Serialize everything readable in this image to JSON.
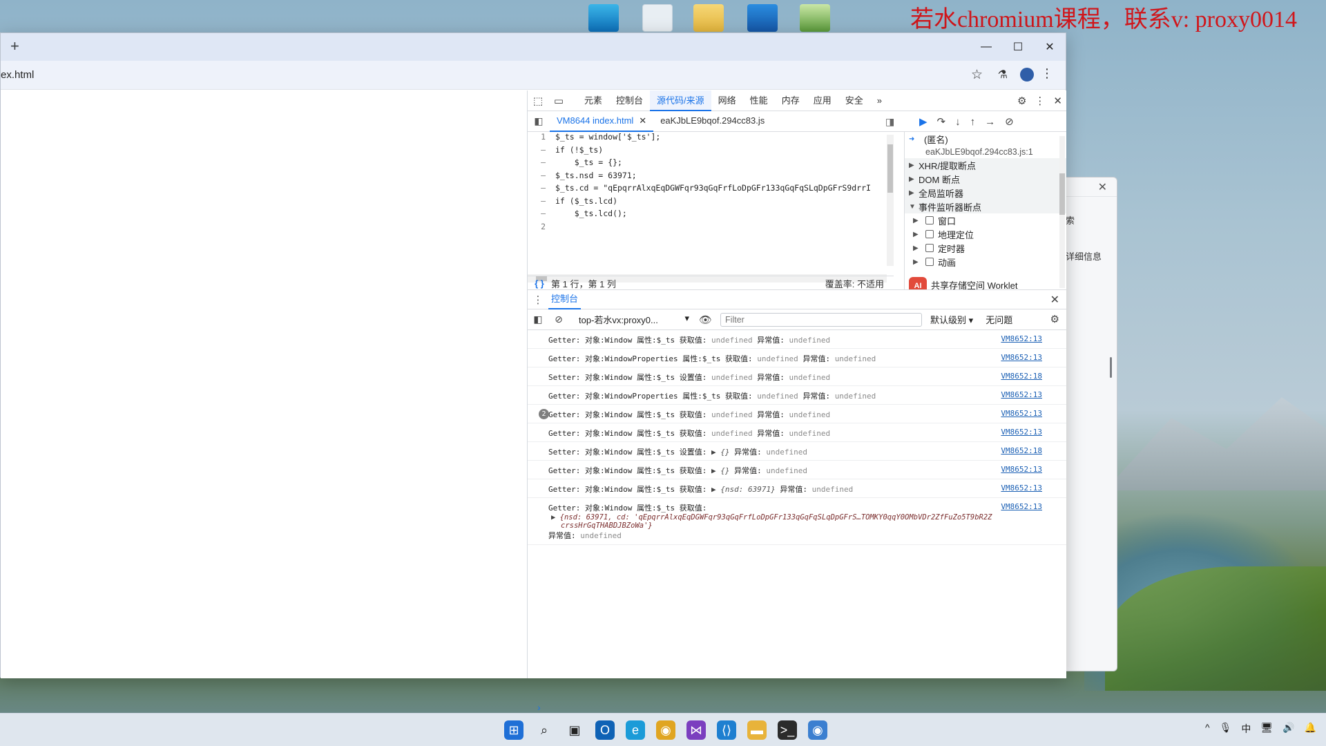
{
  "watermark": "若水chromium课程，联系v: proxy0014",
  "desktop_icons": [
    "monitor-icon",
    "recycle-bin-icon",
    "folder-icon",
    "media-icon",
    "notepad-icon"
  ],
  "back_window": {
    "text1": "索",
    "text2": "详细信息"
  },
  "browser": {
    "new_tab": "+",
    "window_controls": {
      "minimize": "—",
      "maximize": "☐",
      "close": "✕"
    },
    "url": "ex.html"
  },
  "devtools": {
    "tabs": [
      "元素",
      "控制台",
      "源代码/来源",
      "网络",
      "性能",
      "内存",
      "应用",
      "安全"
    ],
    "active_tab": "源代码/来源",
    "more": "»",
    "sources": {
      "file_tabs": [
        {
          "label": "VM8644 index.html",
          "active": true
        },
        {
          "label": "eaKJbLE9bqof.294cc83.js",
          "active": false
        }
      ],
      "code_lines": [
        {
          "ln": "1",
          "code": "$_ts = window['$_ts'];"
        },
        {
          "ln": "–",
          "code": "if (!$_ts)"
        },
        {
          "ln": "–",
          "code": "    $_ts = {};"
        },
        {
          "ln": "–",
          "code": "$_ts.nsd = 63971;"
        },
        {
          "ln": "–",
          "code": "$_ts.cd = \"qEpqrrAlxqEqDGWFqr93qGqFrfLoDpGFr133qGqFqSLqDpGFrS9drrI"
        },
        {
          "ln": "–",
          "code": "if ($_ts.lcd)"
        },
        {
          "ln": "–",
          "code": "    $_ts.lcd();"
        },
        {
          "ln": "2",
          "code": ""
        }
      ],
      "status_position": "第 1 行，第 1 列",
      "coverage": "覆盖率: 不适用"
    },
    "debugger": {
      "anon_label": "(匿名)",
      "anon_file": "eaKJbLE9bqof.294cc83.js:1",
      "sections": [
        {
          "label": "XHR/提取断点",
          "expanded": false
        },
        {
          "label": "DOM 断点",
          "expanded": false
        },
        {
          "label": "全局监听器",
          "expanded": false
        },
        {
          "label": "事件监听器断点",
          "expanded": true
        }
      ],
      "event_items": [
        "窗口",
        "地理定位",
        "定时器",
        "动画"
      ],
      "ai_label": "AI",
      "shared_storage": "共享存储空间 Worklet"
    },
    "console": {
      "drawer_tab": "控制台",
      "context": "top-若水vx:proxy0...",
      "filter_placeholder": "Filter",
      "level": "默认级别 ▾",
      "issues": "无问题",
      "logs": [
        {
          "kind": "Getter:",
          "obj": "Window",
          "action": "获取值:",
          "value": "undefined",
          "exc": "undefined",
          "src": "VM8652:13"
        },
        {
          "kind": "Getter:",
          "obj": "WindowProperties",
          "action": "获取值:",
          "value": "undefined",
          "exc": "undefined",
          "src": "VM8652:13"
        },
        {
          "kind": "Setter:",
          "obj": "Window",
          "action": "设置值:",
          "value": "undefined",
          "exc": "undefined",
          "src": "VM8652:18"
        },
        {
          "kind": "Getter:",
          "obj": "WindowProperties",
          "action": "获取值:",
          "value": "undefined",
          "exc": "undefined",
          "src": "VM8652:13"
        },
        {
          "kind": "Getter:",
          "obj": "Window",
          "action": "获取值:",
          "value": "undefined",
          "exc": "undefined",
          "src": "VM8652:13",
          "count": "2"
        },
        {
          "kind": "Getter:",
          "obj": "Window",
          "action": "获取值:",
          "value": "undefined",
          "exc": "undefined",
          "src": "VM8652:13"
        },
        {
          "kind": "Setter:",
          "obj": "Window",
          "action": "设置值:",
          "value": "{}",
          "exc": "undefined",
          "src": "VM8652:18",
          "expandable": true
        },
        {
          "kind": "Getter:",
          "obj": "Window",
          "action": "获取值:",
          "value": "{}",
          "exc": "undefined",
          "src": "VM8652:13",
          "expandable": true
        },
        {
          "kind": "Getter:",
          "obj": "Window",
          "action": "获取值:",
          "value": "{nsd: 63971}",
          "exc": "undefined",
          "src": "VM8652:13",
          "expandable": true
        }
      ],
      "last_log": {
        "kind": "Getter:",
        "obj": "Window",
        "action": "获取值:",
        "src": "VM8652:13",
        "object_line1": "{nsd: 63971, cd: 'qEpqrrAlxqEqDGWFqr93qGqFrfLoDpGFr133qGqFqSLqDpGFrS…TOMKY0qqY0OMbVDr2ZfFuZo5T9bR2Z",
        "object_line2": "crssHrGqTHABDJBZoWa'}",
        "exc_label": "异常值:",
        "exc": "undefined"
      },
      "label_obj": "对象:",
      "label_prop": "属性:",
      "prop_name": "$_ts",
      "label_exc": "异常值:",
      "prompt": "›"
    }
  },
  "taskbar": {
    "icons": [
      "start-icon",
      "search-icon",
      "task-view-icon",
      "outlook-icon",
      "edge-icon",
      "chrome-icon",
      "visual-studio-icon",
      "vscode-icon",
      "file-explorer-icon",
      "terminal-icon",
      "chromium-icon"
    ],
    "tray": [
      "^",
      "🎙",
      "中",
      "🖥",
      "🔊",
      "🔔"
    ]
  }
}
